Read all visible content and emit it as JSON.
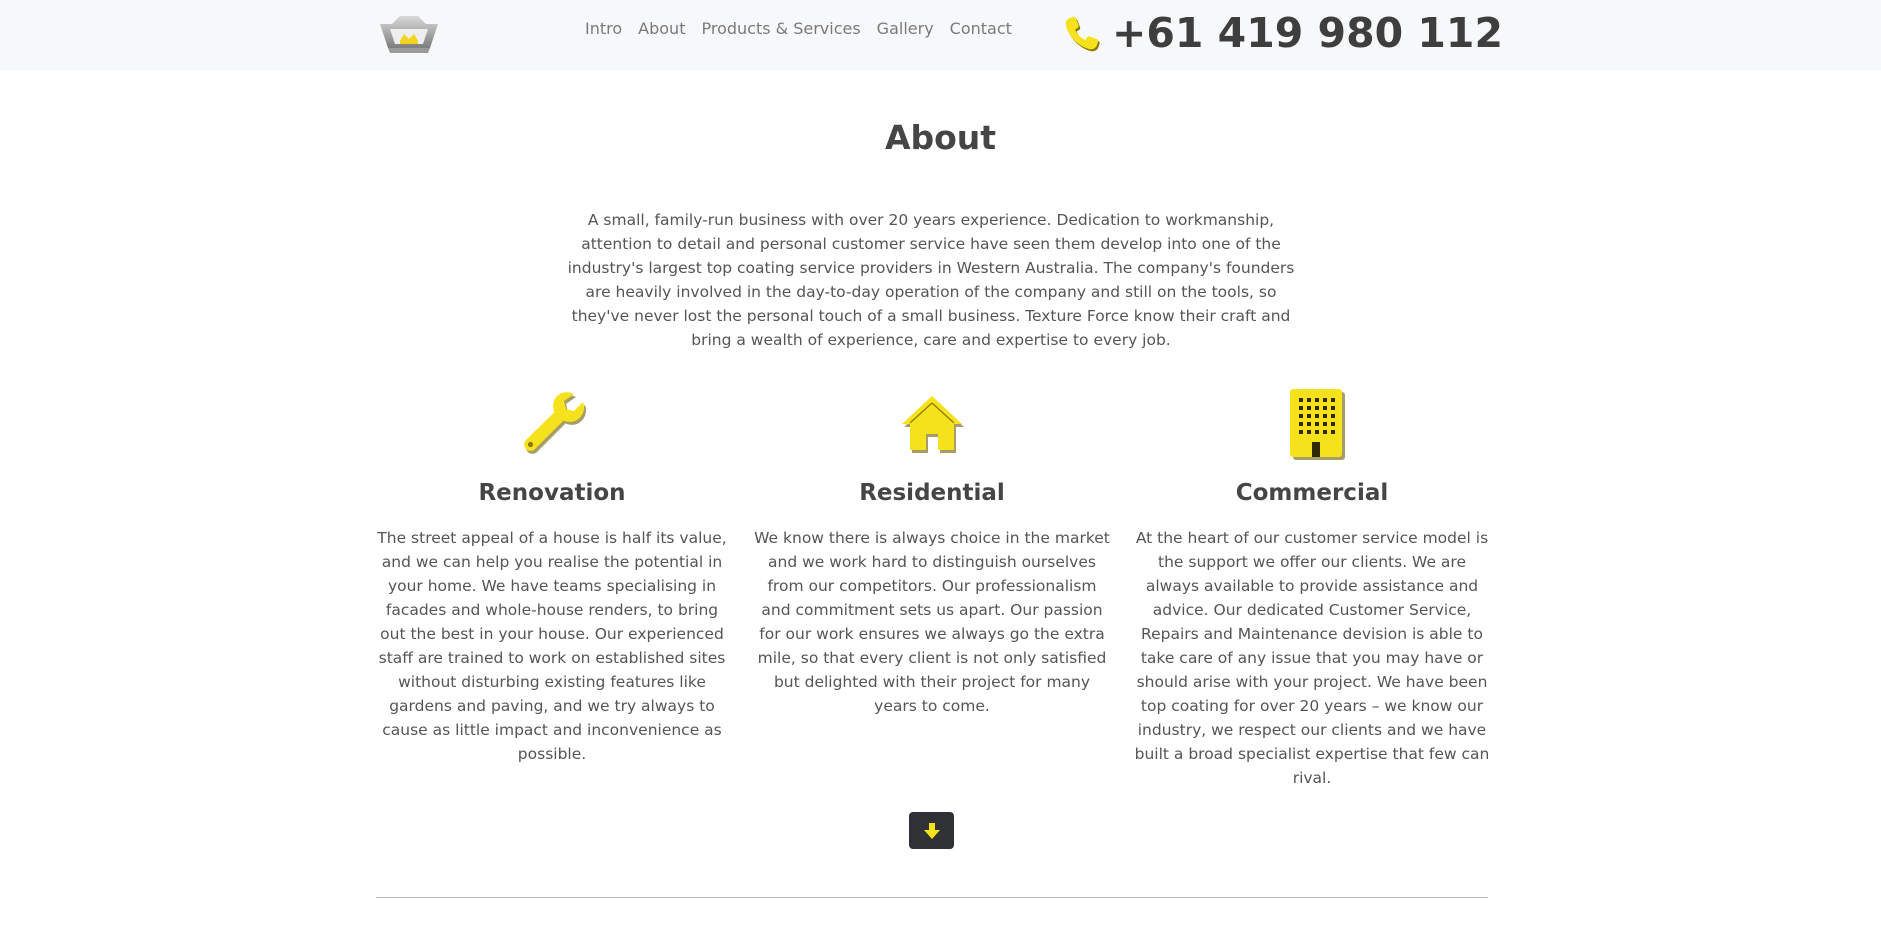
{
  "nav": {
    "links": [
      "Intro",
      "About",
      "Products & Services",
      "Gallery",
      "Contact"
    ],
    "phone": "+61 419 980 112"
  },
  "about": {
    "title": "About",
    "intro": "A small, family-run business with over 20 years experience. Dedication to workmanship, attention to detail and personal customer service have seen them develop into one of the industry's largest top coating service providers in Western Australia. The company's founders are heavily involved in the day-to-day operation of the company and still on the tools, so they've never lost the personal touch of a small business. Texture Force know their craft and bring a wealth of experience, care and expertise to every job.",
    "columns": [
      {
        "icon": "wrench-icon",
        "title": "Renovation",
        "text": "The street appeal of a house is half its value, and we can help you realise the potential in your home. We have teams specialising in facades and whole-house renders, to bring out the best in your house. Our experienced staff are trained to work on established sites without disturbing existing features like gardens and paving, and we try always to cause as little impact and inconvenience as possible."
      },
      {
        "icon": "house-icon",
        "title": "Residential",
        "text": "We know there is always choice in the market and we work hard to distinguish ourselves from our competitors. Our professionalism and commitment sets us apart. Our passion for our work ensures we always go the extra mile, so that every client is not only satisfied but delighted with their project for many years to come."
      },
      {
        "icon": "building-icon",
        "title": "Commercial",
        "text": "At the heart of our customer service model is the support we offer our clients. We are always available to provide assistance and advice. Our dedicated Customer Service, Repairs and Maintenance devision is able to take care of any issue that you may have or should arise with your project. We have been top coating for over 20 years – we know our industry, we respect our clients and we have built a broad specialist expertise that few can rival."
      }
    ]
  },
  "colors": {
    "accent": "#f5e11c",
    "navbar_bg": "#f7f8f9",
    "button_bg": "#2f3134"
  }
}
